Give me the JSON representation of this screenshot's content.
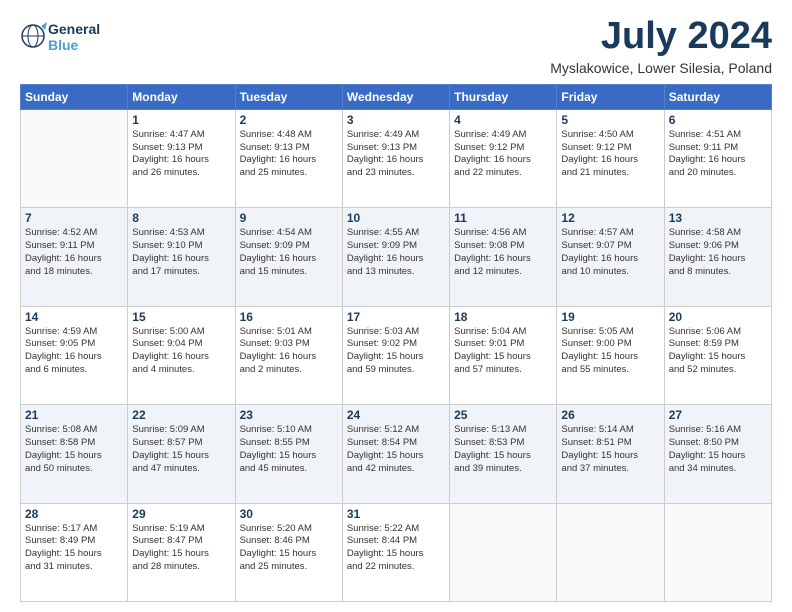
{
  "header": {
    "logo_line1": "General",
    "logo_line2": "Blue",
    "month_title": "July 2024",
    "location": "Myslakowice, Lower Silesia, Poland"
  },
  "weekdays": [
    "Sunday",
    "Monday",
    "Tuesday",
    "Wednesday",
    "Thursday",
    "Friday",
    "Saturday"
  ],
  "weeks": [
    [
      {
        "day": "",
        "info": ""
      },
      {
        "day": "1",
        "info": "Sunrise: 4:47 AM\nSunset: 9:13 PM\nDaylight: 16 hours\nand 26 minutes."
      },
      {
        "day": "2",
        "info": "Sunrise: 4:48 AM\nSunset: 9:13 PM\nDaylight: 16 hours\nand 25 minutes."
      },
      {
        "day": "3",
        "info": "Sunrise: 4:49 AM\nSunset: 9:13 PM\nDaylight: 16 hours\nand 23 minutes."
      },
      {
        "day": "4",
        "info": "Sunrise: 4:49 AM\nSunset: 9:12 PM\nDaylight: 16 hours\nand 22 minutes."
      },
      {
        "day": "5",
        "info": "Sunrise: 4:50 AM\nSunset: 9:12 PM\nDaylight: 16 hours\nand 21 minutes."
      },
      {
        "day": "6",
        "info": "Sunrise: 4:51 AM\nSunset: 9:11 PM\nDaylight: 16 hours\nand 20 minutes."
      }
    ],
    [
      {
        "day": "7",
        "info": "Sunrise: 4:52 AM\nSunset: 9:11 PM\nDaylight: 16 hours\nand 18 minutes."
      },
      {
        "day": "8",
        "info": "Sunrise: 4:53 AM\nSunset: 9:10 PM\nDaylight: 16 hours\nand 17 minutes."
      },
      {
        "day": "9",
        "info": "Sunrise: 4:54 AM\nSunset: 9:09 PM\nDaylight: 16 hours\nand 15 minutes."
      },
      {
        "day": "10",
        "info": "Sunrise: 4:55 AM\nSunset: 9:09 PM\nDaylight: 16 hours\nand 13 minutes."
      },
      {
        "day": "11",
        "info": "Sunrise: 4:56 AM\nSunset: 9:08 PM\nDaylight: 16 hours\nand 12 minutes."
      },
      {
        "day": "12",
        "info": "Sunrise: 4:57 AM\nSunset: 9:07 PM\nDaylight: 16 hours\nand 10 minutes."
      },
      {
        "day": "13",
        "info": "Sunrise: 4:58 AM\nSunset: 9:06 PM\nDaylight: 16 hours\nand 8 minutes."
      }
    ],
    [
      {
        "day": "14",
        "info": "Sunrise: 4:59 AM\nSunset: 9:05 PM\nDaylight: 16 hours\nand 6 minutes."
      },
      {
        "day": "15",
        "info": "Sunrise: 5:00 AM\nSunset: 9:04 PM\nDaylight: 16 hours\nand 4 minutes."
      },
      {
        "day": "16",
        "info": "Sunrise: 5:01 AM\nSunset: 9:03 PM\nDaylight: 16 hours\nand 2 minutes."
      },
      {
        "day": "17",
        "info": "Sunrise: 5:03 AM\nSunset: 9:02 PM\nDaylight: 15 hours\nand 59 minutes."
      },
      {
        "day": "18",
        "info": "Sunrise: 5:04 AM\nSunset: 9:01 PM\nDaylight: 15 hours\nand 57 minutes."
      },
      {
        "day": "19",
        "info": "Sunrise: 5:05 AM\nSunset: 9:00 PM\nDaylight: 15 hours\nand 55 minutes."
      },
      {
        "day": "20",
        "info": "Sunrise: 5:06 AM\nSunset: 8:59 PM\nDaylight: 15 hours\nand 52 minutes."
      }
    ],
    [
      {
        "day": "21",
        "info": "Sunrise: 5:08 AM\nSunset: 8:58 PM\nDaylight: 15 hours\nand 50 minutes."
      },
      {
        "day": "22",
        "info": "Sunrise: 5:09 AM\nSunset: 8:57 PM\nDaylight: 15 hours\nand 47 minutes."
      },
      {
        "day": "23",
        "info": "Sunrise: 5:10 AM\nSunset: 8:55 PM\nDaylight: 15 hours\nand 45 minutes."
      },
      {
        "day": "24",
        "info": "Sunrise: 5:12 AM\nSunset: 8:54 PM\nDaylight: 15 hours\nand 42 minutes."
      },
      {
        "day": "25",
        "info": "Sunrise: 5:13 AM\nSunset: 8:53 PM\nDaylight: 15 hours\nand 39 minutes."
      },
      {
        "day": "26",
        "info": "Sunrise: 5:14 AM\nSunset: 8:51 PM\nDaylight: 15 hours\nand 37 minutes."
      },
      {
        "day": "27",
        "info": "Sunrise: 5:16 AM\nSunset: 8:50 PM\nDaylight: 15 hours\nand 34 minutes."
      }
    ],
    [
      {
        "day": "28",
        "info": "Sunrise: 5:17 AM\nSunset: 8:49 PM\nDaylight: 15 hours\nand 31 minutes."
      },
      {
        "day": "29",
        "info": "Sunrise: 5:19 AM\nSunset: 8:47 PM\nDaylight: 15 hours\nand 28 minutes."
      },
      {
        "day": "30",
        "info": "Sunrise: 5:20 AM\nSunset: 8:46 PM\nDaylight: 15 hours\nand 25 minutes."
      },
      {
        "day": "31",
        "info": "Sunrise: 5:22 AM\nSunset: 8:44 PM\nDaylight: 15 hours\nand 22 minutes."
      },
      {
        "day": "",
        "info": ""
      },
      {
        "day": "",
        "info": ""
      },
      {
        "day": "",
        "info": ""
      }
    ]
  ]
}
